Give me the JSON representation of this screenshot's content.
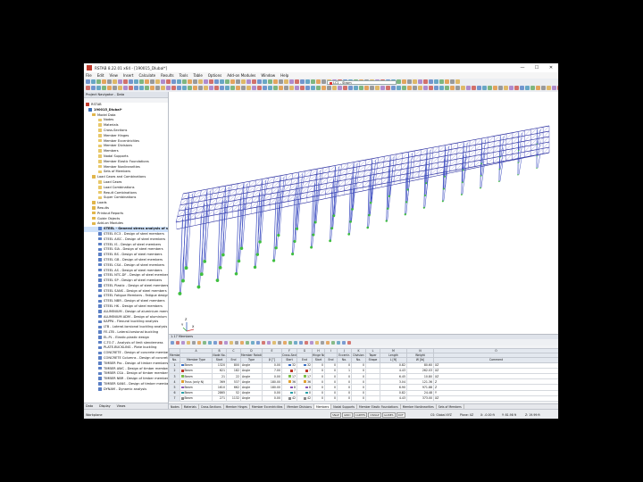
{
  "window": {
    "title": "RSTAB 8.22.01 x64 - [190015_Dlubal*]",
    "controls": [
      "—",
      "☐",
      "✕"
    ]
  },
  "menu": [
    "File",
    "Edit",
    "View",
    "Insert",
    "Calculate",
    "Results",
    "Tools",
    "Table",
    "Options",
    "Add-on Modules",
    "Window",
    "Help"
  ],
  "toolbar": {
    "load_case": "LC1 - Strom"
  },
  "navigator": {
    "header": "Project Navigator - Data",
    "root": "RSTAB",
    "model": "190015_Dlubal*",
    "items": [
      "Model Data",
      "Nodes",
      "Materials",
      "Cross-Sections",
      "Member Hinges",
      "Member Eccentricities",
      "Member Divisions",
      "Members",
      "Nodal Supports",
      "Member Elastic Foundations",
      "Member Nonlinearities",
      "Sets of Members",
      "Load Cases and Combinations",
      "Load Cases",
      "Load Combinations",
      "Result Combinations",
      "Super Combinations",
      "Loads",
      "Results",
      "Printout Reports",
      "Guide Objects",
      "Add-on Modules",
      "STEEL - General stress analysis of steel members",
      "STEEL EC3 - Design of steel members",
      "STEEL AISC - Design of steel members",
      "STEEL IS - Design of steel members",
      "STEEL SIA - Design of steel members",
      "STEEL BS - Design of steel members",
      "STEEL GB - Design of steel members",
      "STEEL CSA - Design of steel members",
      "STEEL AS - Design of steel members",
      "STEEL NTC-DF - Design of steel members",
      "STEEL SP - Design of steel members",
      "STEEL Plastic - Design of steel members",
      "STEEL SANS - Design of steel members",
      "STEEL Fatigue Members - Fatigue design",
      "STEEL NBR - Design of steel members",
      "STEEL HK - Design of steel members",
      "ALUMINIUM - Design of aluminium members",
      "ALUMINIUM ADM - Design of aluminium",
      "KAPPA - Flexural buckling analysis",
      "LTB - Lateral-torsional buckling analysis",
      "FE-LTB - Lateral-torsional buckling",
      "EL-PL - Elastic-plastic design",
      "C-TO-T - Analysis of limit slenderness",
      "PLATE-BUCKLING - Plate buckling",
      "CONCRETE - Design of concrete members",
      "CONCRETE Columns - Design of concrete",
      "TIMBER Pro - Design of timber members",
      "TIMBER AWC - Design of timber members",
      "TIMBER CSA - Design of timber members",
      "TIMBER NBR - Design of timber members",
      "TIMBER SANS - Design of timber members",
      "DYNAM - Dynamic analysis"
    ],
    "tabs": [
      "Data",
      "Display",
      "Views"
    ]
  },
  "table": {
    "title": "1.17 Members",
    "col_letters": [
      "",
      "A",
      "B",
      "C",
      "D",
      "E",
      "F",
      "G",
      "H",
      "I",
      "J",
      "K",
      "L",
      "M",
      "N",
      "O"
    ],
    "head1": [
      "Member",
      "",
      "Node No.",
      "",
      "Member Rotation",
      "",
      "Cross-Section No.",
      "",
      "Hinge No.",
      "",
      "Eccentr.",
      "Division",
      "Taper",
      "Length",
      "Weight",
      ""
    ],
    "head2": [
      "No.",
      "Member Type",
      "Start",
      "End",
      "Type",
      "β [°]",
      "Start",
      "End",
      "Start",
      "End",
      "No.",
      "No.",
      "Shape",
      "L [ft]",
      "W [lb]",
      "Comment"
    ],
    "rows": [
      [
        "1",
        "Beam",
        "1320",
        "800",
        "Angle",
        "0.00",
        "32",
        "32",
        "0",
        "0",
        "0",
        "0",
        "",
        "0.82",
        "80.60",
        "XZ"
      ],
      [
        "2",
        "Beam",
        "621",
        "182",
        "Angle",
        "7.00",
        "7",
        "7",
        "0",
        "0",
        "1",
        "0",
        "",
        "4.43",
        "262.03",
        "XZ"
      ],
      [
        "3",
        "Beam",
        "21",
        "22",
        "Angle",
        "0.00",
        "17",
        "17",
        "0",
        "0",
        "0",
        "0",
        "",
        "6.45",
        "10.80",
        "XZ"
      ],
      [
        "4",
        "Truss (only N)",
        "369",
        "537",
        "Angle",
        "180.00",
        "36",
        "36",
        "0",
        "0",
        "0",
        "0",
        "",
        "3.04",
        "121.36",
        "Z"
      ],
      [
        "5",
        "Beam",
        "1610",
        "662",
        "Angle",
        "180.00",
        "8",
        "8",
        "0",
        "0",
        "0",
        "0",
        "",
        "6.90",
        "971.88",
        "Z"
      ],
      [
        "6",
        "Beam",
        "2865",
        "52",
        "Angle",
        "0.00",
        "0",
        "0",
        "0",
        "0",
        "0",
        "0",
        "",
        "0.82",
        "24.48",
        "Y"
      ],
      [
        "7",
        "Beam",
        "271",
        "1132",
        "Angle",
        "0.00",
        "42",
        "42",
        "0",
        "0",
        "0",
        "0",
        "",
        "4.43",
        "373.00",
        "XZ"
      ]
    ],
    "tabs": [
      "Nodes",
      "Materials",
      "Cross-Sections",
      "Member Hinges",
      "Member Eccentricities",
      "Member Divisions",
      "Members",
      "Nodal Supports",
      "Member Elastic Foundations",
      "Member Nonlinearities",
      "Sets of Members"
    ],
    "active_tab": "Members"
  },
  "status": {
    "left": "Workplane",
    "toggles": [
      "SNAP",
      "GRID",
      "CARTES",
      "OSNAP",
      "GLINES",
      "DXF"
    ],
    "cs": "CS: Global XYZ",
    "plane": "Plane: XZ",
    "x": "X: -0.00 ft",
    "y": "Y: 81.98 ft",
    "z": "Z: 19.99 ft"
  },
  "axis_labels": {
    "x": "X",
    "y": "Y",
    "z": "Z"
  }
}
